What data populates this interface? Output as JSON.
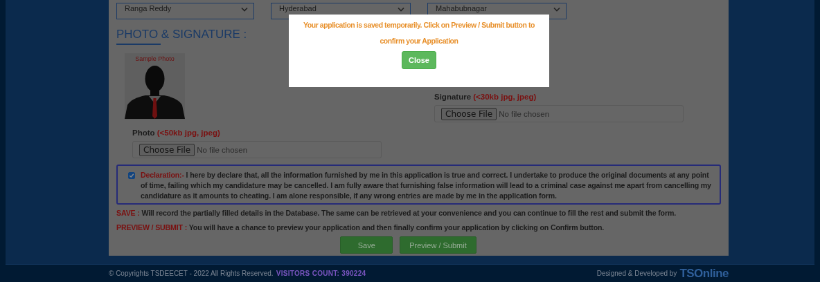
{
  "district_selects": [
    {
      "value": "Ranga Reddy"
    },
    {
      "value": "Hyderabad"
    },
    {
      "value": "Mahabubnagar"
    }
  ],
  "section_title": "PHOTO & SIGNATURE :",
  "photo": {
    "sample_caption": "Sample Photo",
    "label": "Photo",
    "hint": "(<50kb jpg, jpeg)",
    "choose_button": "Choose File",
    "status": "No file chosen"
  },
  "signature": {
    "label": "Signature",
    "hint": "(<30kb jpg, jpeg)",
    "choose_button": "Choose File",
    "status": "No file chosen"
  },
  "declaration": {
    "checked": true,
    "lead": "Declaration:-",
    "text": "I here by declare that, all the information furnished by me in this application is true and correct. I undertake to produce the original documents at any point of time, failing which my candidature may be cancelled. I am fully aware that furnishing false information will lead to a criminal case against me apart from cancelling my candidature as it amounts to cheating. I am alone responsible, if any wrong entries are made by me in the application form."
  },
  "notes": [
    {
      "term": "SAVE :",
      "text": "Will record the partially filled details in the Database. The same can be retrieved at your convenience and you can continue to fill the rest and submit the form."
    },
    {
      "term": "PREVIEW / SUBMIT :",
      "text": "You will have a chance to preview your application and then finally confirm your application by clicking on Confirm button."
    }
  ],
  "buttons": [
    "Save",
    "Preview / Submit"
  ],
  "footer": {
    "copyright": "© Copyrights TSDEECET - 2022 All Rights Reserved.",
    "visitors": "VISITORS COUNT: 390224",
    "credit": "Designed & Developed by",
    "brand": "TSOnline"
  },
  "modal": {
    "message": "Your application is saved temporarily. Click on Preview / Submit button to confirm your Application",
    "button": "Close"
  }
}
